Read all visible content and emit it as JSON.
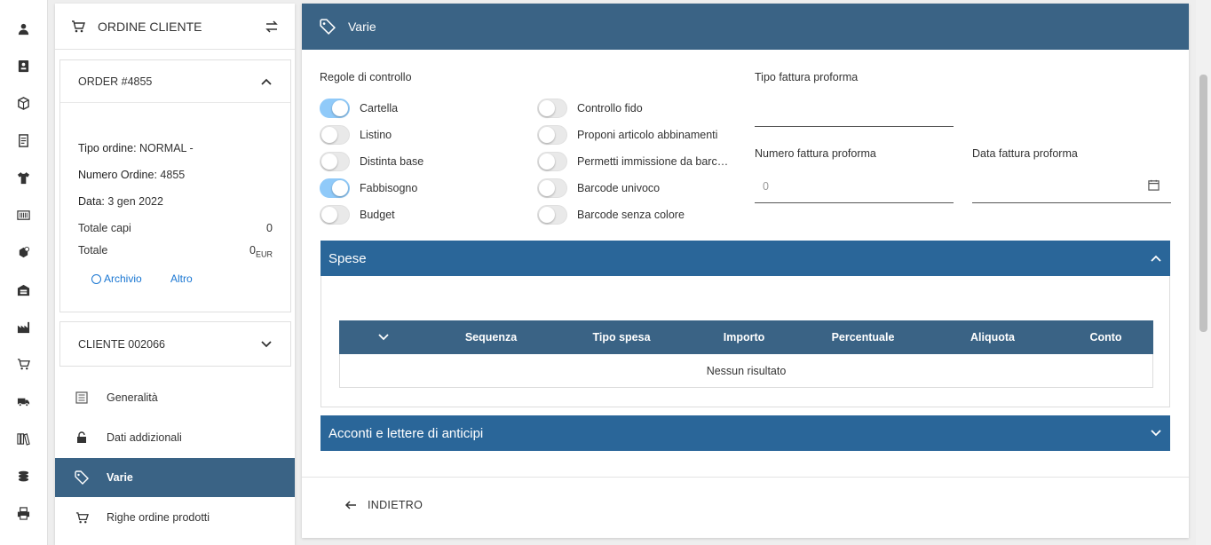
{
  "rail": {
    "icons": [
      "user-icon",
      "contact-card-icon",
      "box-icon",
      "document-icon",
      "shirt-icon",
      "barcode-icon",
      "production-icon",
      "warehouse-icon",
      "factory-icon",
      "cart-icon",
      "truck-icon",
      "books-icon",
      "coins-icon",
      "printer-icon"
    ]
  },
  "order_panel": {
    "title": "ORDINE CLIENTE",
    "order_card": {
      "title": "ORDER #4855",
      "tipo_label": "Tipo ordine:",
      "tipo_value": " NORMAL -",
      "numero_label": "Numero Ordine:",
      "numero_value": " 4855",
      "data_label": "Data:",
      "data_value": " 3 gen 2022",
      "totale_capi_label": "Totale capi",
      "totale_capi_value": "0",
      "totale_label": "Totale",
      "totale_value": "0",
      "totale_currency": "EUR",
      "archivio_link": "Archivio",
      "altro_link": "Altro"
    },
    "client_card": {
      "title": "CLIENTE 002066"
    },
    "nav": [
      {
        "label": "Generalità",
        "icon": "list-icon"
      },
      {
        "label": "Dati addizionali",
        "icon": "unlock-icon"
      },
      {
        "label": "Varie",
        "icon": "tag-icon",
        "active": true
      },
      {
        "label": "Righe ordine prodotti",
        "icon": "cart-icon"
      }
    ]
  },
  "main": {
    "title": "Varie",
    "regole_label": "Regole di controllo",
    "toggles_left": [
      {
        "label": "Cartella",
        "on": true
      },
      {
        "label": "Listino",
        "on": false
      },
      {
        "label": "Distinta base",
        "on": false
      },
      {
        "label": "Fabbisogno",
        "on": true
      },
      {
        "label": "Budget",
        "on": false
      }
    ],
    "toggles_right": [
      {
        "label": "Controllo fido",
        "on": false
      },
      {
        "label": "Proponi articolo abbinamenti",
        "on": false
      },
      {
        "label": "Permetti immissione da barc…",
        "on": false
      },
      {
        "label": "Barcode univoco",
        "on": false
      },
      {
        "label": "Barcode senza colore",
        "on": false
      }
    ],
    "tipo_fattura_label": "Tipo fattura proforma",
    "tipo_fattura_value": "",
    "numero_fattura_label": "Numero fattura proforma",
    "numero_fattura_value": "0",
    "data_fattura_label": "Data fattura proforma",
    "data_fattura_value": "",
    "spese": {
      "title": "Spese",
      "columns": [
        "Sequenza",
        "Tipo spesa",
        "Importo",
        "Percentuale",
        "Aliquota",
        "Conto"
      ],
      "empty_text": "Nessun risultato"
    },
    "acconti": {
      "title": "Acconti e lettere di anticipi"
    },
    "back_label": "INDIETRO"
  }
}
